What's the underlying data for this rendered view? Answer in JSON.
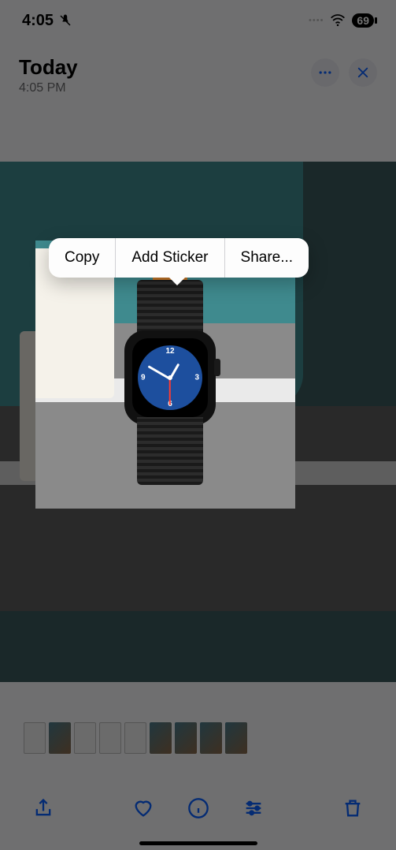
{
  "status": {
    "time": "4:05",
    "battery": "69"
  },
  "header": {
    "title": "Today",
    "subtitle": "4:05 PM"
  },
  "menu": {
    "copy": "Copy",
    "add_sticker": "Add Sticker",
    "share": "Share..."
  },
  "colors": {
    "accent": "#0a60ff",
    "teal_bg": "#3f8a8e",
    "dim_overlay": "rgba(0,0,0,0.55)"
  },
  "toolbar_icons": [
    "share",
    "heart",
    "info",
    "sliders",
    "trash"
  ],
  "thumbnails_count": 9
}
